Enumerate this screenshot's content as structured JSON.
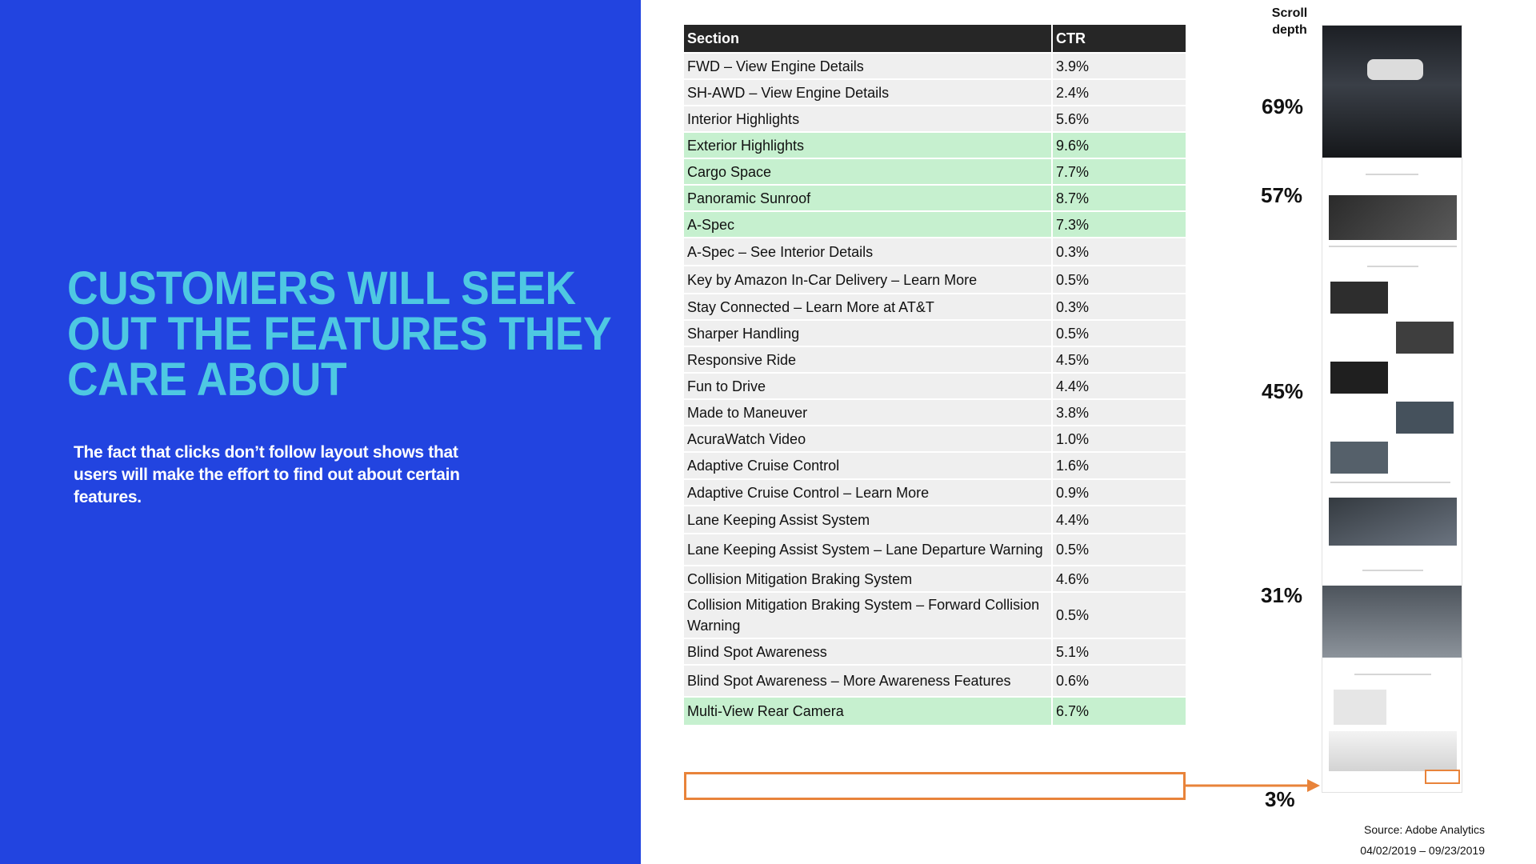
{
  "headline": [
    "CUSTOMERS WILL SEEK",
    "OUT THE FEATURES THEY",
    "CARE ABOUT"
  ],
  "subtext": "The fact that clicks don’t follow layout shows that users will make the effort to find out about certain features.",
  "table": {
    "headers": [
      "Section",
      "CTR"
    ],
    "rows": [
      {
        "section": "FWD – View Engine Details",
        "ctr": "3.9%",
        "highlight": false
      },
      {
        "section": "SH-AWD – View Engine Details",
        "ctr": "2.4%",
        "highlight": false
      },
      {
        "section": "Interior Highlights",
        "ctr": "5.6%",
        "highlight": false
      },
      {
        "section": "Exterior Highlights",
        "ctr": "9.6%",
        "highlight": true
      },
      {
        "section": "Cargo Space",
        "ctr": "7.7%",
        "highlight": true
      },
      {
        "section": "Panoramic Sunroof",
        "ctr": "8.7%",
        "highlight": true
      },
      {
        "section": "A-Spec",
        "ctr": "7.3%",
        "highlight": true
      },
      {
        "section": "A-Spec – See Interior Details",
        "ctr": "0.3%",
        "highlight": false
      },
      {
        "section": "Key by Amazon In-Car Delivery – Learn More",
        "ctr": "0.5%",
        "highlight": false
      },
      {
        "section": "Stay Connected – Learn More at AT&T",
        "ctr": "0.3%",
        "highlight": false
      },
      {
        "section": "Sharper Handling",
        "ctr": "0.5%",
        "highlight": false
      },
      {
        "section": "Responsive Ride",
        "ctr": "4.5%",
        "highlight": false
      },
      {
        "section": "Fun to Drive",
        "ctr": "4.4%",
        "highlight": false
      },
      {
        "section": "Made to Maneuver",
        "ctr": "3.8%",
        "highlight": false
      },
      {
        "section": "AcuraWatch Video",
        "ctr": "1.0%",
        "highlight": false
      },
      {
        "section": "Adaptive Cruise Control",
        "ctr": "1.6%",
        "highlight": false
      },
      {
        "section": "Adaptive Cruise Control – Learn More",
        "ctr": "0.9%",
        "highlight": false
      },
      {
        "section": "Lane Keeping Assist System",
        "ctr": "4.4%",
        "highlight": false
      },
      {
        "section": "Lane Keeping Assist System – Lane Departure Warning",
        "ctr": "0.5%",
        "highlight": false
      },
      {
        "section": "Collision Mitigation Braking System",
        "ctr": "4.6%",
        "highlight": false
      },
      {
        "section": "Collision Mitigation Braking System – Forward Collision Warning",
        "ctr": "0.5%",
        "highlight": false
      },
      {
        "section": "Blind Spot Awareness",
        "ctr": "5.1%",
        "highlight": false
      },
      {
        "section": "Blind Spot Awareness – More Awareness Features",
        "ctr": "0.6%",
        "highlight": false
      },
      {
        "section": "Multi-View Rear Camera",
        "ctr": "6.7%",
        "highlight": true
      }
    ]
  },
  "scroll_depth": {
    "title": [
      "Scroll",
      "depth"
    ],
    "values": [
      "69%",
      "57%",
      "45%",
      "31%",
      "3%"
    ]
  },
  "source": {
    "line1": "Source: Adobe Analytics",
    "line2": "04/02/2019 – 09/23/2019"
  },
  "colors": {
    "panel": "#2244e0",
    "headline": "#4ec8e2",
    "header_row": "#262626",
    "row": "#efefef",
    "row_highlight": "#c6f0cf",
    "callout": "#e8833a"
  }
}
